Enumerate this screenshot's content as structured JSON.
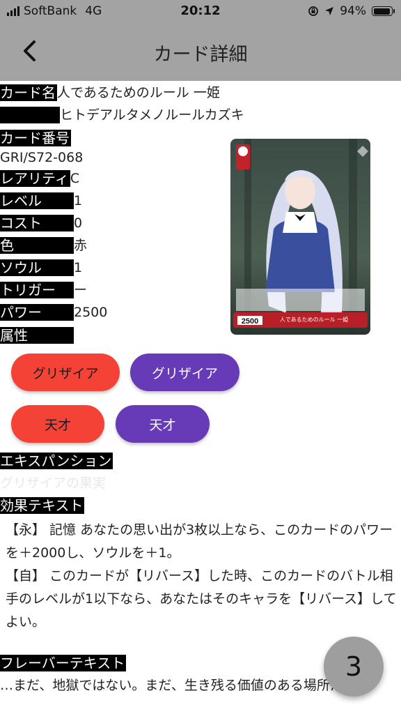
{
  "status_bar": {
    "carrier": "SoftBank",
    "network": "4G",
    "time": "20:12",
    "battery": "94%",
    "battery_level": 0.94
  },
  "header": {
    "title": "カード詳細",
    "back_icon": "chevron-left-icon"
  },
  "card": {
    "name_label": "カード名",
    "name": "人であるためのルール 一姫",
    "kana": "ヒトデアルタメノルールカズキ",
    "number_label": "カード番号",
    "number": "GRI/S72-068",
    "rarity_label": "レアリティ",
    "rarity": "C",
    "level_label": "レベル",
    "level": "1",
    "cost_label": "コスト",
    "cost": "0",
    "color_label": "色",
    "color": "赤",
    "soul_label": "ソウル",
    "soul": "1",
    "trigger_label": "トリガー",
    "trigger": "ー",
    "power_label": "パワー",
    "power": "2500",
    "attribute_label": "属性",
    "expansion_label": "エキスパンション",
    "expansion": "グリザイアの果実",
    "effect_label": "効果テキスト",
    "effect_1": "【永】 記憶 あなたの思い出が3枚以上なら、このカードのパワーを＋2000し、ソウルを＋1。",
    "effect_2": "【自】 このカードが【リバース】した時、このカードのバトル相手のレベルが1以下なら、あなたはそのキャラを【リバース】してよい。",
    "flavor_label": "フレーバーテキスト",
    "flavor": "…まだ、地獄ではない。まだ、生き残る価値のある場所だわ…",
    "image_power": "2500",
    "image_name": "人であるためのルール 一姫"
  },
  "chips": [
    {
      "label": "グリザイア"
    },
    {
      "label": "グリザイア"
    },
    {
      "label": "天才"
    },
    {
      "label": "天才"
    }
  ],
  "fab": {
    "label": "3"
  },
  "colors": {
    "header_bg": "#a3a3a3",
    "chip_red": "#f44336",
    "chip_purple": "#673ab7",
    "fab_bg": "#9e9e9e"
  }
}
